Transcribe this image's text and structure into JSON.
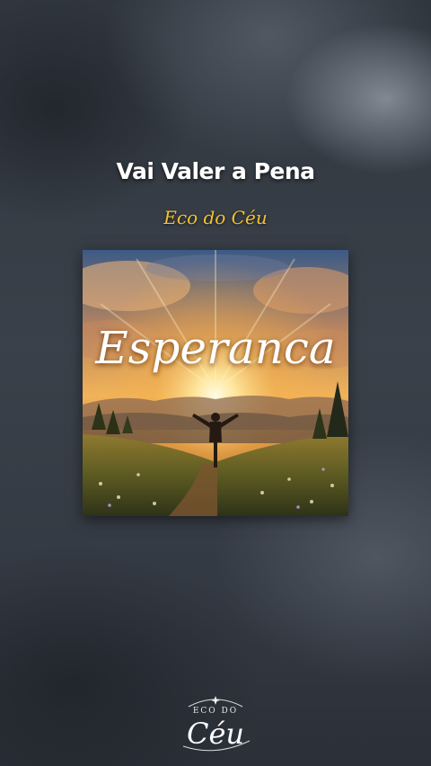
{
  "song": {
    "title": "Vai Valer a Pena",
    "artist": "Eco do Céu"
  },
  "cover": {
    "title": "Esperanca"
  },
  "logo": {
    "top_text": "ECO DO",
    "main_text": "Céu"
  },
  "colors": {
    "artist_accent": "#f2c230",
    "background": "#343a43"
  }
}
